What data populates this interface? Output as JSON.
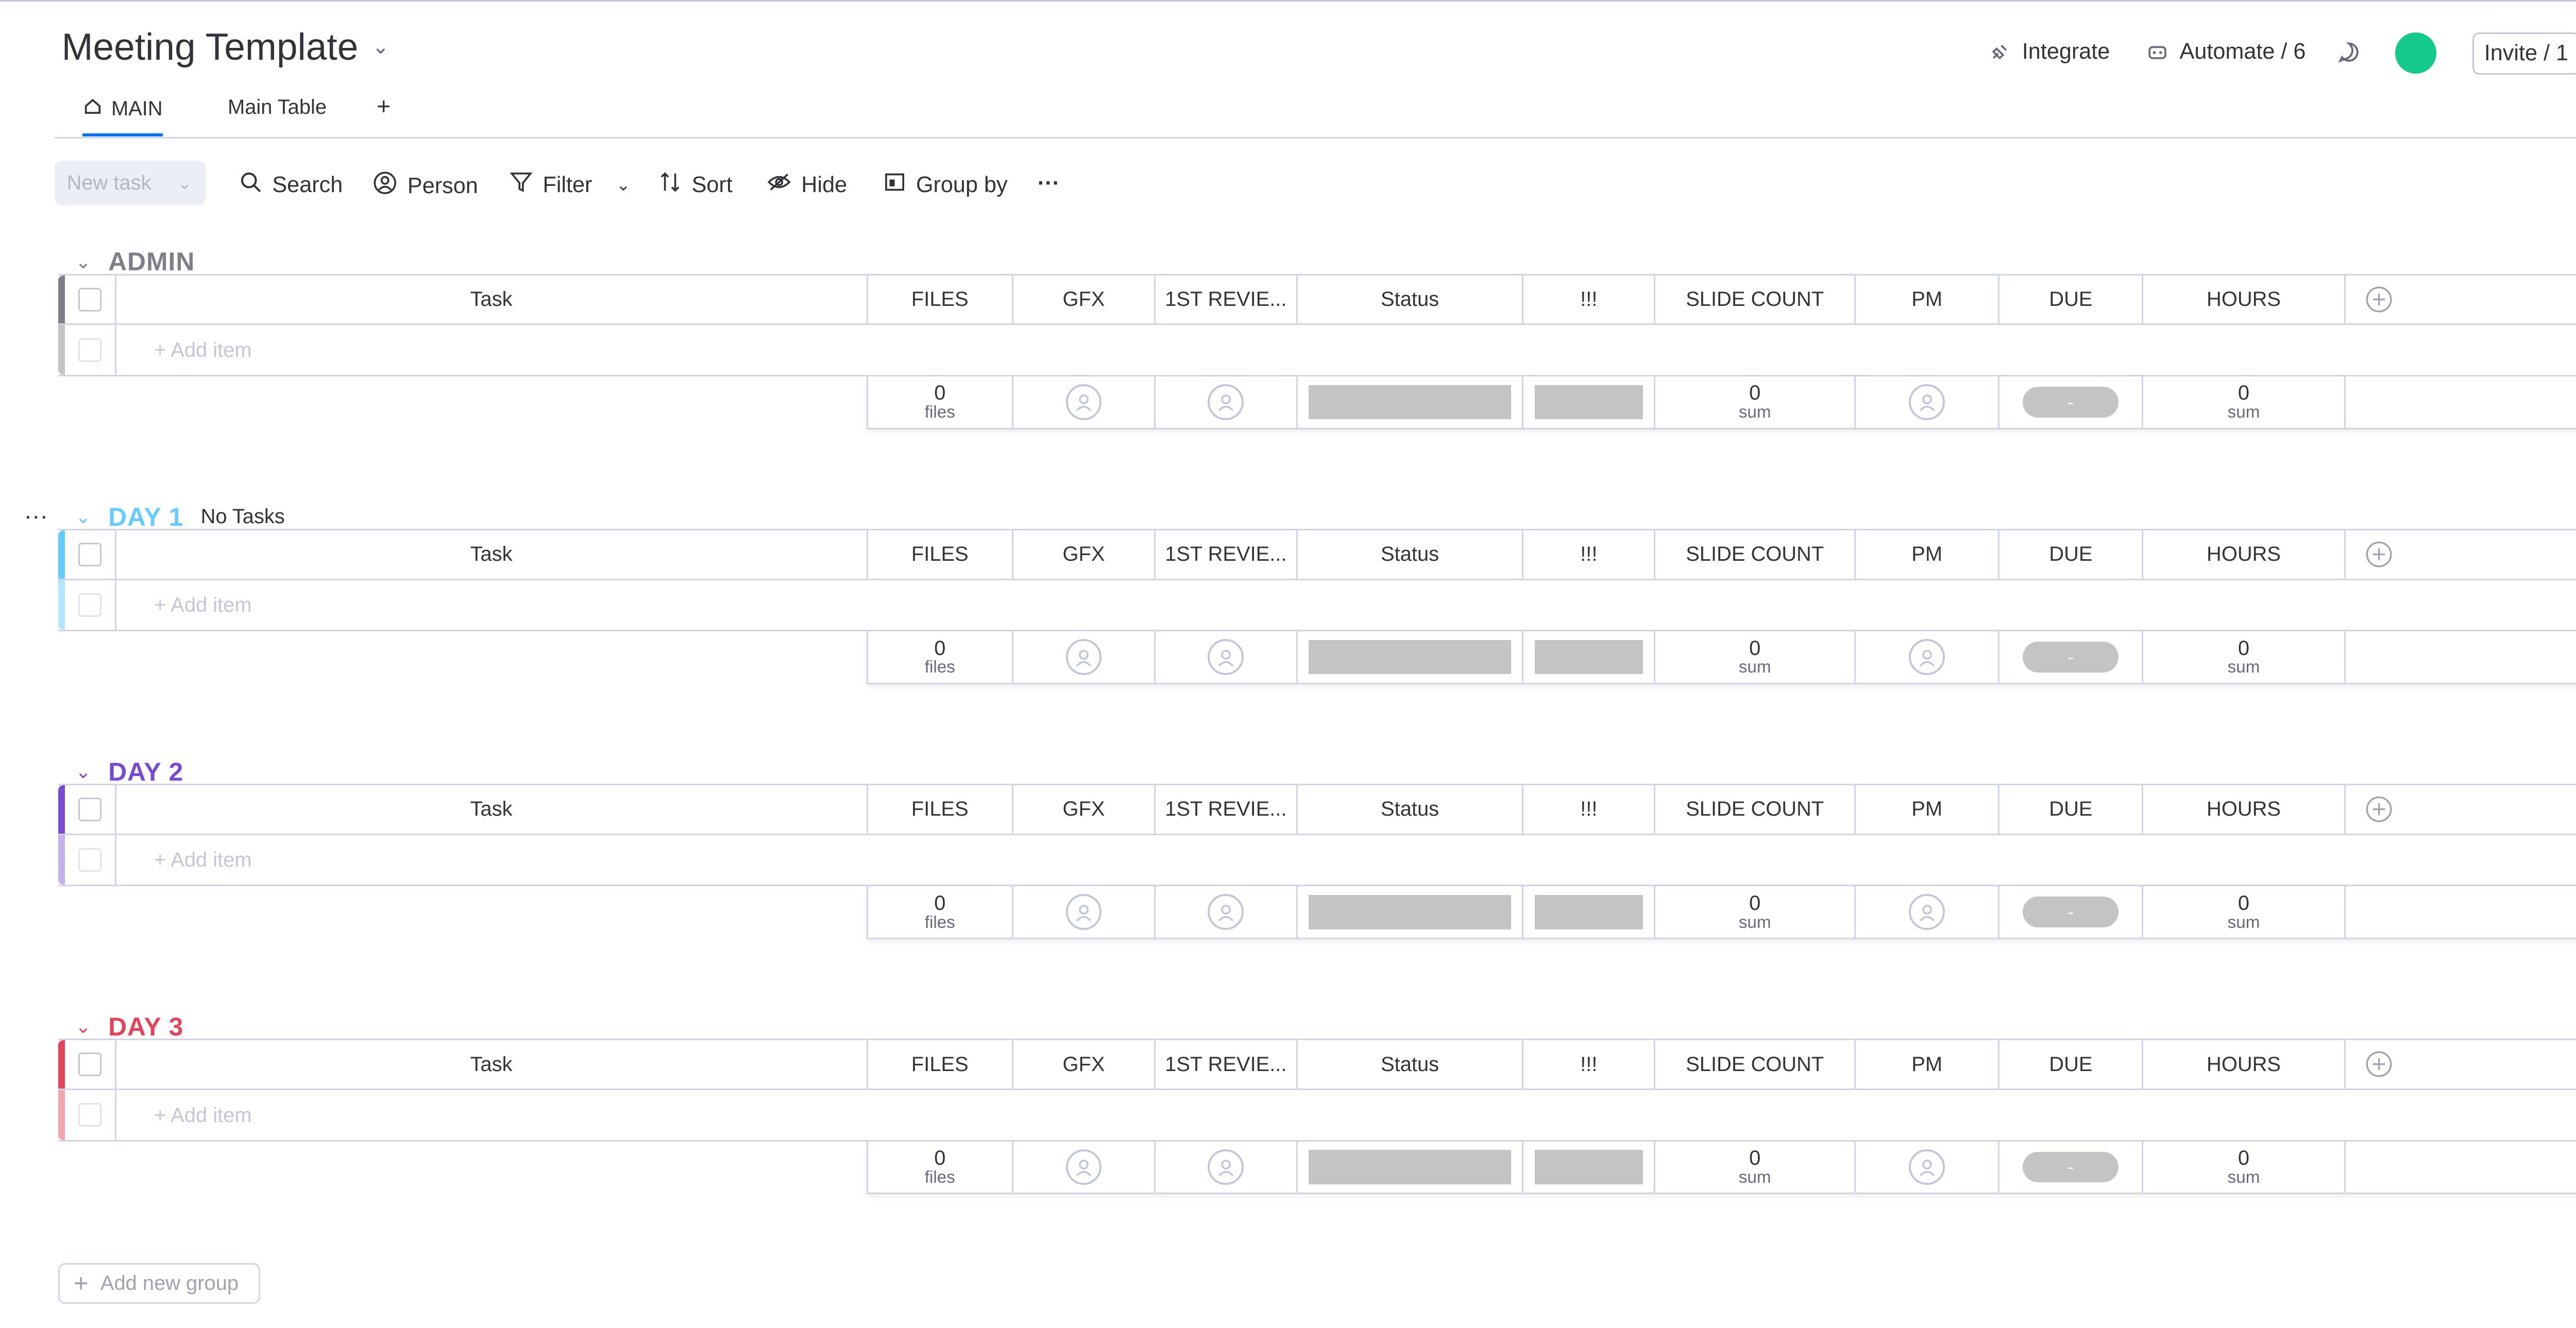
{
  "board": {
    "title": "Meeting Template",
    "header_actions": {
      "integrate": "Integrate",
      "automate": "Automate / 6",
      "invite": "Invite / 1",
      "avatar_color": "#14c98b"
    },
    "tabs": [
      {
        "label": "MAIN",
        "active": true
      },
      {
        "label": "Main Table",
        "active": false
      }
    ],
    "add_tab": "+"
  },
  "toolbar": {
    "new_task": "New task",
    "search": "Search",
    "person": "Person",
    "filter": "Filter",
    "sort": "Sort",
    "hide": "Hide",
    "group_by": "Group by",
    "more": "···"
  },
  "columns": {
    "task": "Task",
    "files": "FILES",
    "gfx": "GFX",
    "first_review": "1ST REVIE...",
    "status": "Status",
    "priority": "!!!",
    "slide_count": "SLIDE COUNT",
    "pm": "PM",
    "due": "DUE",
    "hours": "HOURS"
  },
  "add_item_label": "+ Add item",
  "summary": {
    "files_value": "0",
    "files_unit": "files",
    "slide_value": "0",
    "slide_unit": "sum",
    "hours_value": "0",
    "hours_unit": "sum",
    "due_value": "-"
  },
  "groups": [
    {
      "name": "ADMIN",
      "color": "#7d7f89",
      "bar_color": "#c4c4c4",
      "subtitle": ""
    },
    {
      "name": "DAY 1",
      "color": "#66ccff",
      "bar_color": "#b3e5fc",
      "subtitle": "No Tasks"
    },
    {
      "name": "DAY 2",
      "color": "#784bd1",
      "bar_color": "#c4b3ea",
      "subtitle": ""
    },
    {
      "name": "DAY 3",
      "color": "#e2445c",
      "bar_color": "#f4a3b0",
      "subtitle": ""
    }
  ],
  "group_more": "···",
  "add_new_group": "Add new group"
}
